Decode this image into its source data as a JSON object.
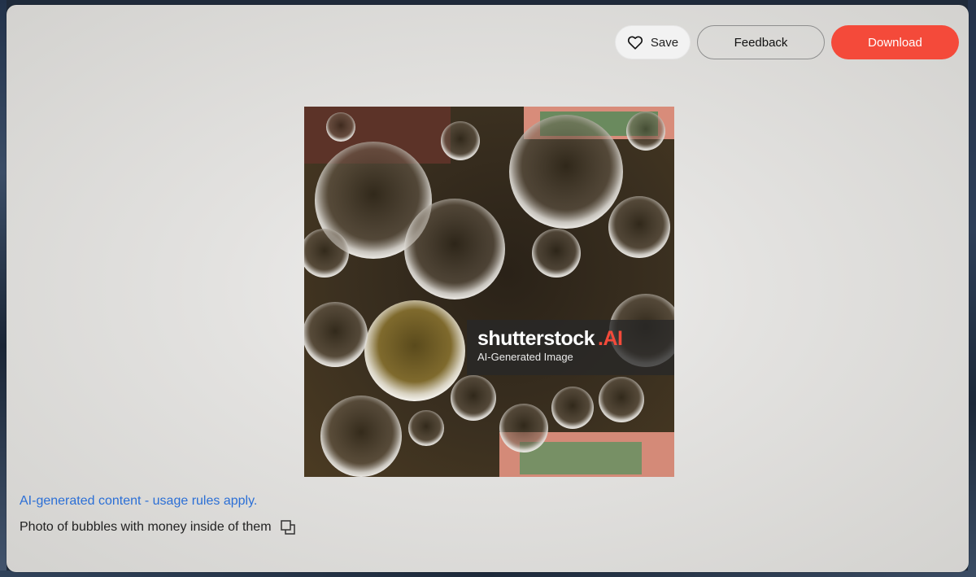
{
  "toolbar": {
    "save_label": "Save",
    "feedback_label": "Feedback",
    "download_label": "Download"
  },
  "image": {
    "watermark_brand": "shutterstock",
    "watermark_ai": ".AI",
    "watermark_subtitle": "AI-Generated Image"
  },
  "footer": {
    "usage_link": "AI-generated content - usage rules apply.",
    "caption": "Photo of bubbles with money inside of them"
  },
  "colors": {
    "accent": "#f44a3a",
    "link": "#2b6fd6"
  },
  "icons": [
    "heart-icon",
    "copy-icon"
  ]
}
